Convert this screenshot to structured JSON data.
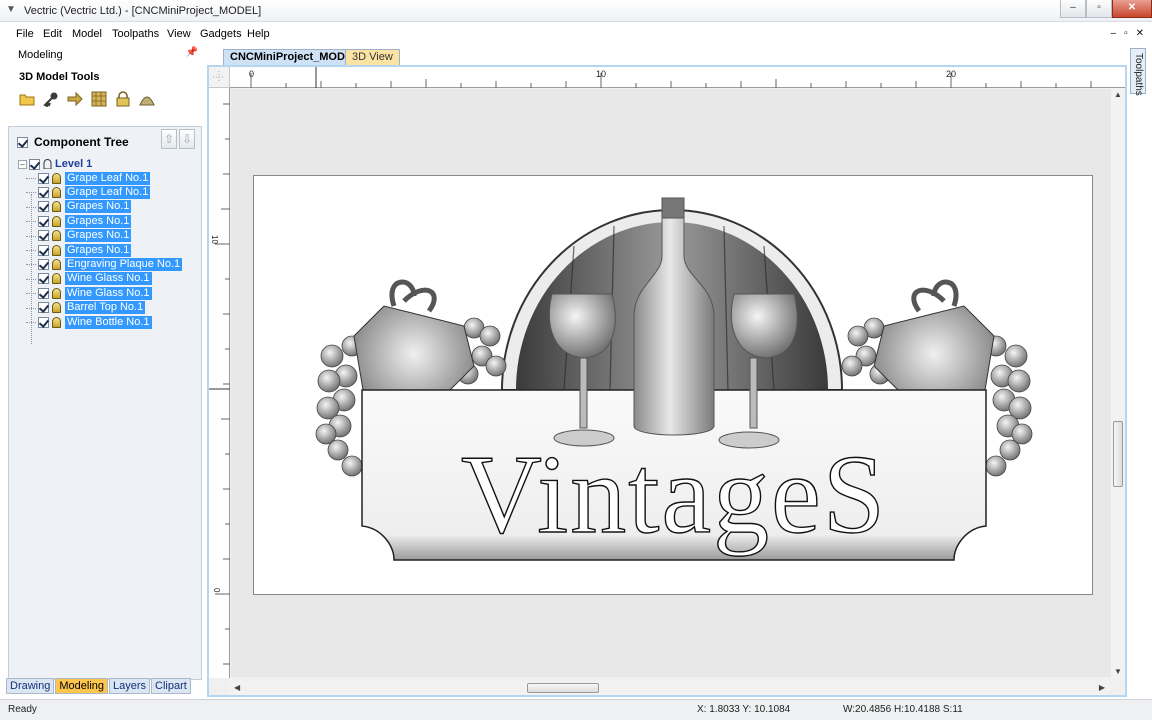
{
  "window": {
    "title": "Vectric (Vectric Ltd.) - [CNCMiniProject_MODEL]",
    "buttons": [
      "–",
      "▫",
      "✕"
    ]
  },
  "menu": {
    "items": [
      "File",
      "Edit",
      "Model",
      "Toolpaths",
      "View",
      "Gadgets",
      "Help"
    ],
    "mdi_buttons": [
      "–",
      "▫",
      "✕"
    ]
  },
  "left_panel": {
    "header": "Modeling",
    "tools_title": "3D Model Tools",
    "tools": [
      "folder-icon",
      "key-icon",
      "arrow-icon",
      "grid-icon",
      "lock-icon",
      "mound-icon"
    ],
    "component_tree": {
      "title": "Component Tree",
      "level_label": "Level 1",
      "items": [
        "Grape Leaf No.1",
        "Grape Leaf No.1",
        "Grapes No.1",
        "Grapes No.1",
        "Grapes No.1",
        "Grapes No.1",
        "Engraving Plaque No.1",
        "Wine Glass No.1",
        "Wine Glass No.1",
        "Barrel Top No.1",
        "Wine Bottle No.1"
      ]
    },
    "bottom_tabs": [
      "Drawing",
      "Modeling",
      "Layers",
      "Clipart"
    ],
    "active_bottom_tab": "Modeling"
  },
  "document_tabs": {
    "active": "CNCMiniProject_MODEL",
    "other": "3D View"
  },
  "side_tab": "Toolpaths",
  "ruler": {
    "h_labels": [
      "0",
      "10",
      "20"
    ],
    "v_labels": [
      "10",
      "0"
    ]
  },
  "design": {
    "text": "VintageS"
  },
  "status": {
    "ready": "Ready",
    "coords": "X:  1.8033 Y: 10.1084",
    "size": "W:20.4856   H:10.4188   S:11"
  }
}
